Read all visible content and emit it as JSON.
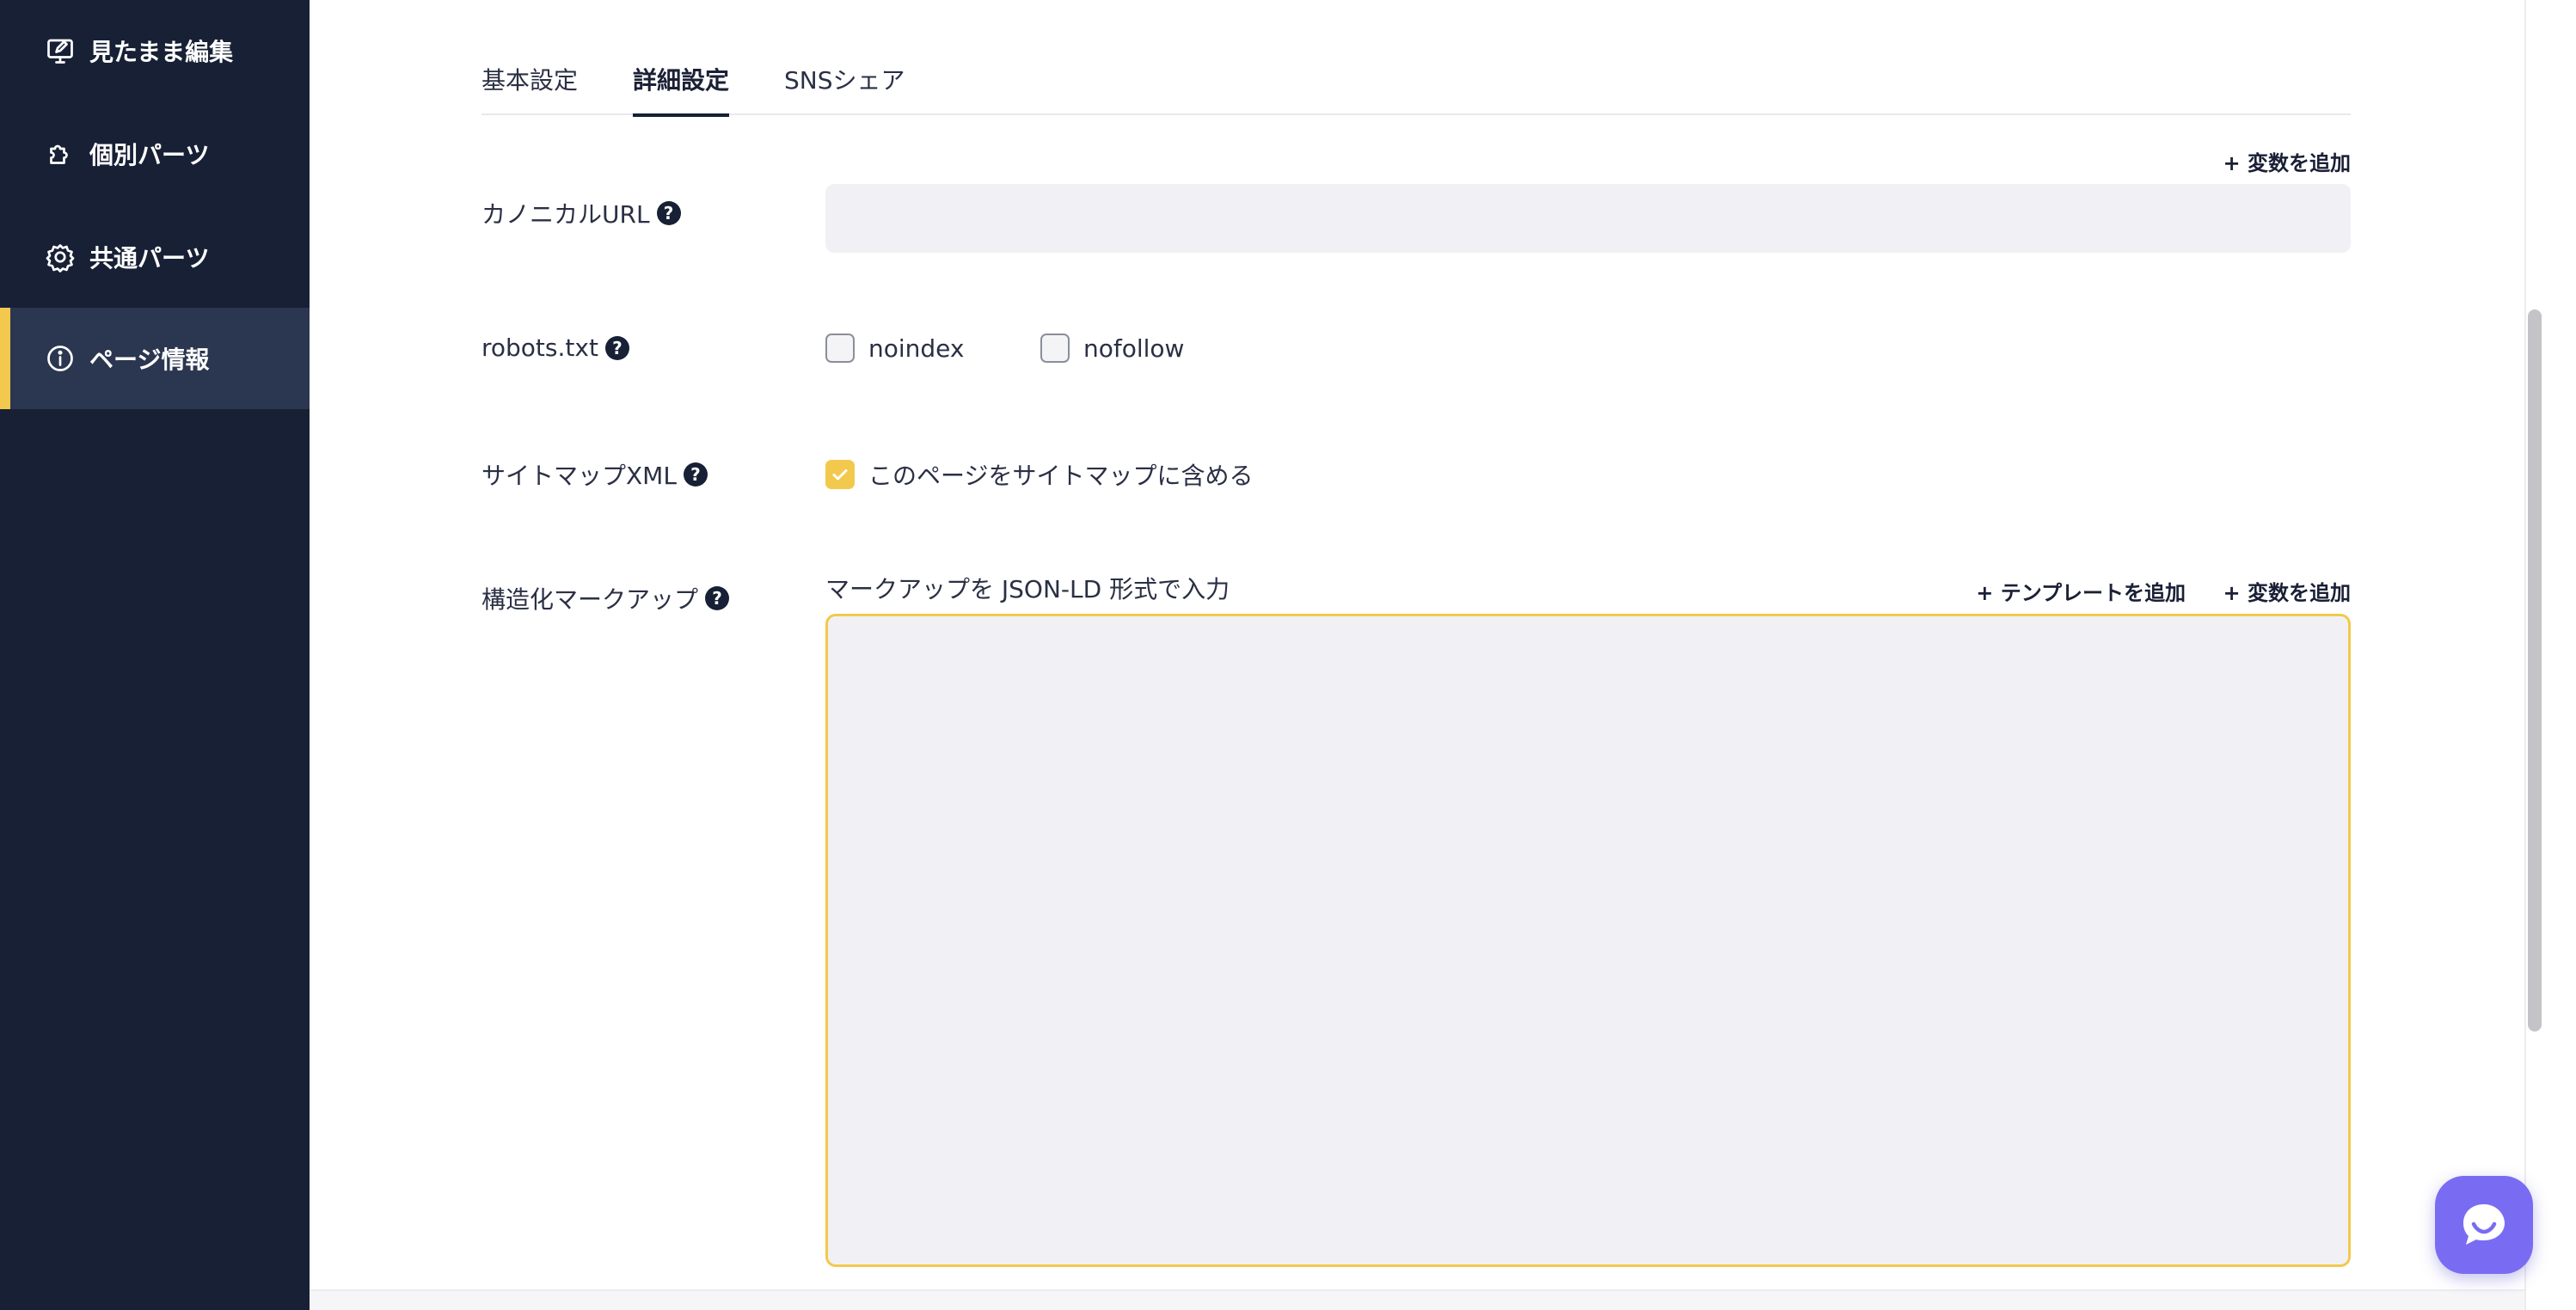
{
  "sidebar": {
    "items": [
      {
        "label": "見たまま編集",
        "icon": "monitor-edit-icon"
      },
      {
        "label": "個別パーツ",
        "icon": "puzzle-icon"
      },
      {
        "label": "共通パーツ",
        "icon": "gear-badge-icon"
      },
      {
        "label": "ページ情報",
        "icon": "info-icon",
        "active": true
      }
    ]
  },
  "tabs": [
    {
      "label": "基本設定"
    },
    {
      "label": "詳細設定",
      "active": true
    },
    {
      "label": "SNSシェア"
    }
  ],
  "canonical": {
    "label": "カノニカルURL",
    "add_variable": "+ 変数を追加",
    "value": ""
  },
  "robots": {
    "label": "robots.txt",
    "noindex": "noindex",
    "nofollow": "nofollow"
  },
  "sitemap": {
    "label": "サイトマップXML",
    "include": "このページをサイトマップに含める"
  },
  "structured": {
    "label": "構造化マークアップ",
    "sub_label": "マークアップを JSON-LD 形式で入力",
    "add_template": "+ テンプレートを追加",
    "add_variable": "+ 変数を追加",
    "value": ""
  },
  "help_glyph": "?",
  "colors": {
    "sidebar_bg": "#182035",
    "sidebar_active": "#2b3650",
    "accent": "#f2c94c",
    "chat": "#7a6cf2"
  }
}
